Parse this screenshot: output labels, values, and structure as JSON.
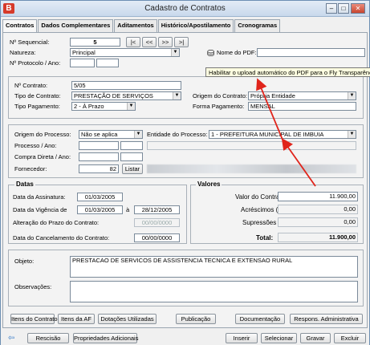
{
  "window": {
    "title": "Cadastro de Contratos",
    "icon_letter": "B",
    "min": "‒",
    "max": "□",
    "close": "✕"
  },
  "tabs": [
    "Contratos",
    "Dados Complementares",
    "Aditamentos",
    "Histórico/Apostilamento",
    "Cronogramas"
  ],
  "header": {
    "seq_label": "Nº Sequencial:",
    "seq_value": "5",
    "nav": [
      "|<",
      "<<",
      ">>",
      ">|"
    ],
    "natureza_label": "Natureza:",
    "natureza_value": "Principal",
    "protocolo_label": "Nº Protocolo / Ano:",
    "pdf_label": "Nome do PDF:",
    "tooltip": "Habilitar o upload automático do PDF para o Fly Transparência"
  },
  "contrato": {
    "numero_label": "Nº Contrato:",
    "numero_value": "5/05",
    "tipo_label": "Tipo de Contrato:",
    "tipo_value": "PRESTAÇÃO DE SERVIÇOS",
    "origem_label": "Origem do Contrato:",
    "origem_value": "Própria Entidade",
    "pagto_label": "Tipo Pagamento:",
    "pagto_value": "2 - À Prazo",
    "forma_label": "Forma Pagamento:",
    "forma_value": "MENSAL"
  },
  "processo": {
    "origem_label": "Origem do Processo:",
    "origem_value": "Não se aplica",
    "entidade_label": "Entidade do Processo:",
    "entidade_value": "1 - PREFEITURA MUNICIPAL DE IMBUIA",
    "proc_label": "Processo / Ano:",
    "compra_label": "Compra Direta / Ano:",
    "fornecedor_label": "Fornecedor:",
    "fornecedor_value": "82",
    "listar": "Listar"
  },
  "datas": {
    "title": "Datas",
    "assinatura_label": "Data da Assinatura:",
    "assinatura_value": "01/03/2005",
    "vigencia_label": "Data da Vigência de",
    "vigencia_from": "01/03/2005",
    "vigencia_sep": "à",
    "vigencia_to": "28/12/2005",
    "alteracao_label": "Alteração do Prazo do Contrato:",
    "alteracao_value": "00/00/0000",
    "cancelamento_label": "Data do Cancelamento do Contrato:",
    "cancelamento_value": "00/00/0000"
  },
  "valores": {
    "title": "Valores",
    "valor_label": "Valor do Contrato:",
    "valor_value": "11.900,00",
    "acresc_label": "Acréscimos (+):",
    "acresc_value": "0,00",
    "supress_label": "Supressões (-):",
    "supress_value": "0,00",
    "total_label": "Total:",
    "total_value": "11.900,00"
  },
  "objeto": {
    "label": "Objeto:",
    "value": "PRESTACAO DE SERVICOS DE ASSISTENCIA TECNICA E EXTENSAO RURAL",
    "obs_label": "Observações:"
  },
  "actions": [
    "Itens do Contrato",
    "Itens da AF",
    "Dotações Utilizadas",
    "Publicação",
    "Documentação",
    "Respons. Administrativa"
  ],
  "bottom": {
    "rescisao": "Rescisão",
    "propriedades": "Propriedades Adicionais",
    "inserir": "Inserir",
    "selecionar": "Selecionar",
    "gravar": "Gravar",
    "excluir": "Excluir"
  },
  "colors": {
    "arrow": "#e0241b",
    "accent": "#d63a2a"
  }
}
